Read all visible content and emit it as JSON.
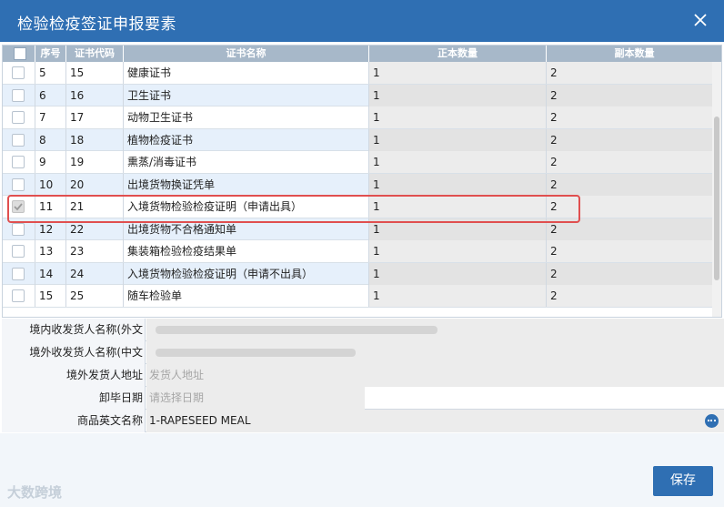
{
  "dialog": {
    "title": "检验检疫签证申报要素",
    "close_icon": "close-icon"
  },
  "grid": {
    "headers": {
      "seq": "序号",
      "code": "证书代码",
      "name": "证书名称",
      "orig": "正本数量",
      "copy": "副本数量"
    },
    "rows": [
      {
        "seq": "5",
        "code": "15",
        "name": "健康证书",
        "orig": "1",
        "copy": "2",
        "checked": false
      },
      {
        "seq": "6",
        "code": "16",
        "name": "卫生证书",
        "orig": "1",
        "copy": "2",
        "checked": false
      },
      {
        "seq": "7",
        "code": "17",
        "name": "动物卫生证书",
        "orig": "1",
        "copy": "2",
        "checked": false
      },
      {
        "seq": "8",
        "code": "18",
        "name": "植物检疫证书",
        "orig": "1",
        "copy": "2",
        "checked": false
      },
      {
        "seq": "9",
        "code": "19",
        "name": "熏蒸/消毒证书",
        "orig": "1",
        "copy": "2",
        "checked": false
      },
      {
        "seq": "10",
        "code": "20",
        "name": "出境货物换证凭单",
        "orig": "1",
        "copy": "2",
        "checked": false
      },
      {
        "seq": "11",
        "code": "21",
        "name": "入境货物检验检疫证明（申请出具）",
        "orig": "1",
        "copy": "2",
        "checked": true
      },
      {
        "seq": "12",
        "code": "22",
        "name": "出境货物不合格通知单",
        "orig": "1",
        "copy": "2",
        "checked": false
      },
      {
        "seq": "13",
        "code": "23",
        "name": "集装箱检验检疫结果单",
        "orig": "1",
        "copy": "2",
        "checked": false
      },
      {
        "seq": "14",
        "code": "24",
        "name": "入境货物检验检疫证明（申请不出具）",
        "orig": "1",
        "copy": "2",
        "checked": false
      },
      {
        "seq": "15",
        "code": "25",
        "name": "随车检验单",
        "orig": "1",
        "copy": "2",
        "checked": false
      }
    ]
  },
  "form": {
    "domestic_consignee_label": "境内收发货人名称(外文",
    "foreign_consignee_label": "境外收发货人名称(中文",
    "foreign_shipper_address_label": "境外发货人地址",
    "foreign_shipper_address_placeholder": "发货人地址",
    "unload_date_label": "卸毕日期",
    "unload_date_placeholder": "请选择日期",
    "goods_en_name_label": "商品英文名称",
    "goods_en_name_value": "1-RAPESEED MEAL"
  },
  "footer": {
    "save_label": "保存",
    "watermark": "大数跨境"
  },
  "colors": {
    "title_bar": "#2f6fb3",
    "header_bg": "#a7b8c9",
    "highlight": "#e04f4f"
  }
}
